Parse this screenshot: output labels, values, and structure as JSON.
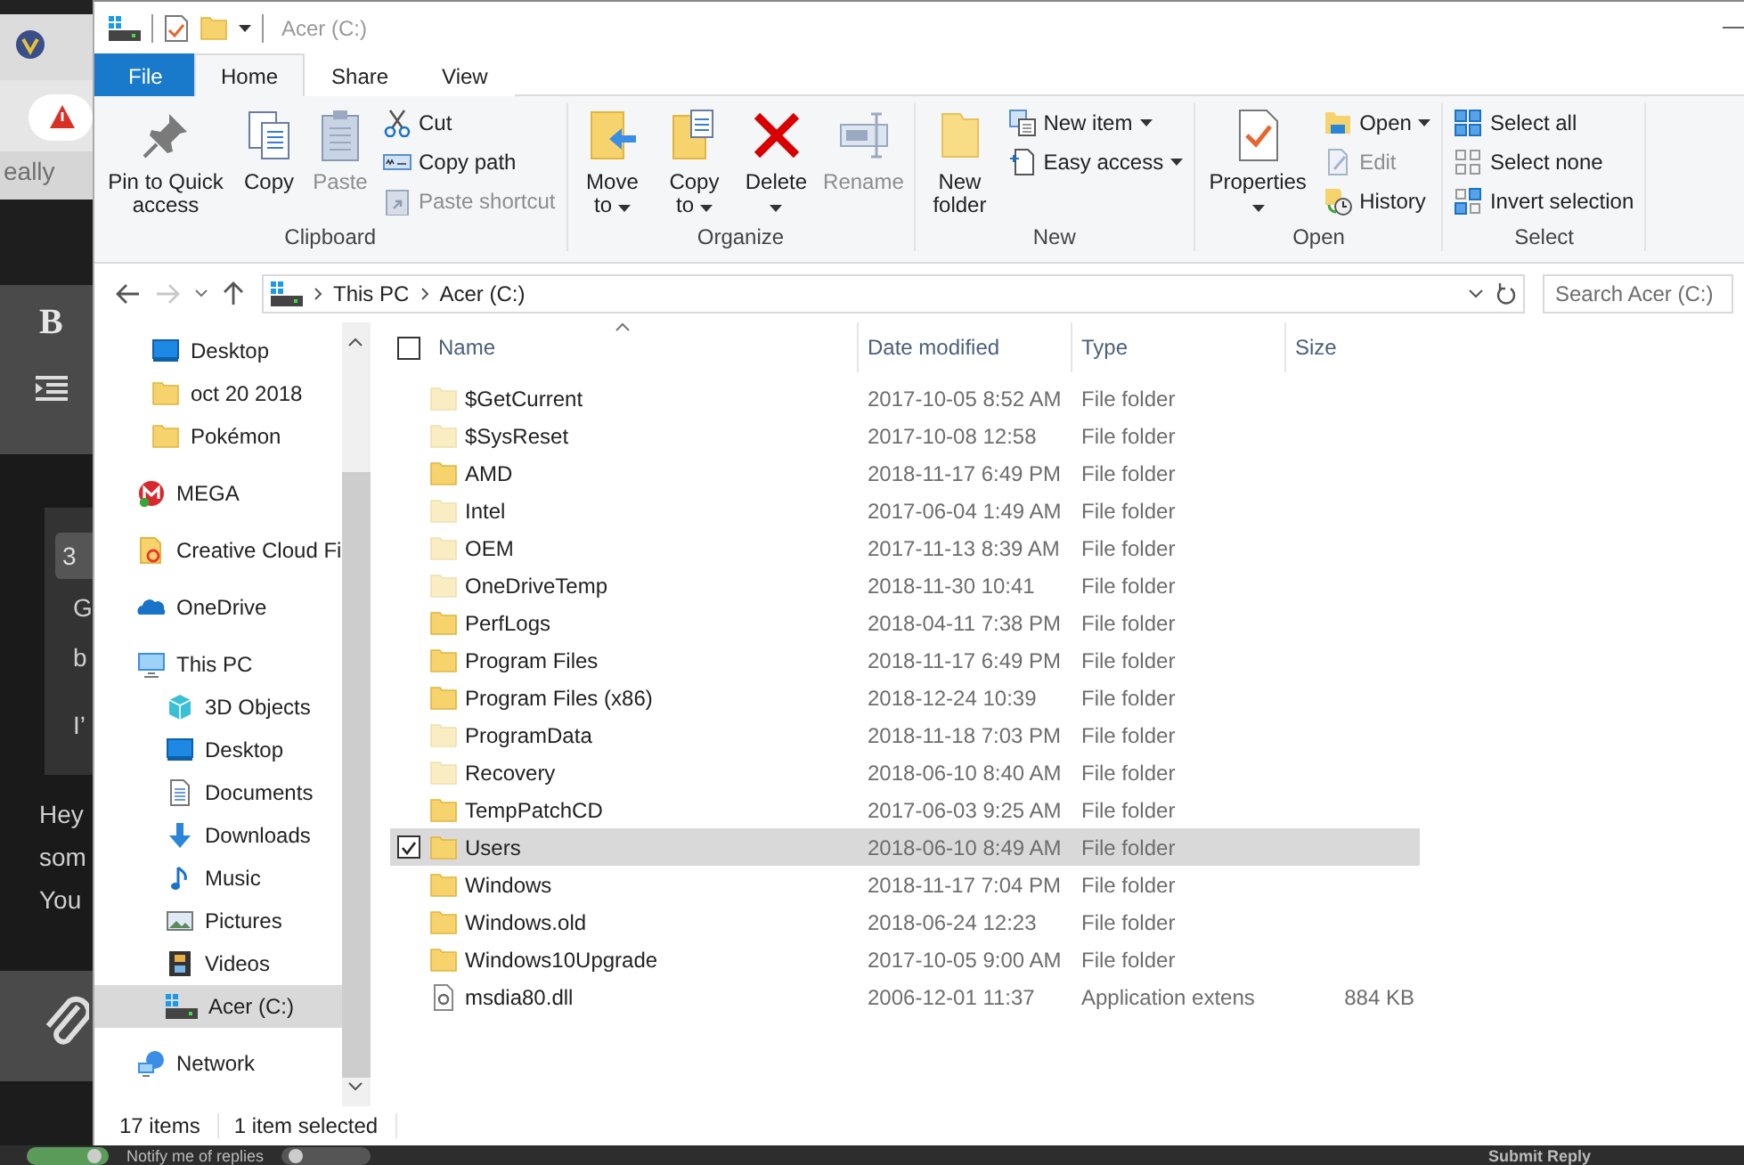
{
  "background_page": {
    "faint_text": "eally",
    "toolbar": {
      "bold": "B"
    },
    "card": {
      "chip": "3",
      "lines": [
        "G",
        "b",
        "I’"
      ]
    },
    "lines": [
      "Hey",
      "som",
      "You"
    ],
    "footer": {
      "notify_toggle": {
        "on": true
      },
      "notify": "Notify me of replies",
      "second_toggle": {
        "on": false
      },
      "submit": "Submit Reply"
    }
  },
  "window": {
    "title": "Acer (C:)"
  },
  "ribbon": {
    "tabs": [
      {
        "label": "File",
        "kind": "file",
        "selected": false
      },
      {
        "label": "Home",
        "kind": "tab",
        "selected": true
      },
      {
        "label": "Share",
        "kind": "tab",
        "selected": false
      },
      {
        "label": "View",
        "kind": "tab",
        "selected": false
      }
    ],
    "groups": [
      {
        "label": "Clipboard",
        "commands": [
          {
            "label": "Pin to Quick access",
            "kind": "pin",
            "large": true,
            "disabled": false,
            "dropdown": false
          },
          {
            "label": "Copy",
            "kind": "copy",
            "large": true,
            "disabled": false,
            "dropdown": false
          },
          {
            "label": "Paste",
            "kind": "paste",
            "large": true,
            "disabled": true,
            "dropdown": false
          },
          {
            "label": "Cut",
            "kind": "cut",
            "large": false,
            "disabled": false,
            "dropdown": false
          },
          {
            "label": "Copy path",
            "kind": "copy-path",
            "large": false,
            "disabled": false,
            "dropdown": false
          },
          {
            "label": "Paste shortcut",
            "kind": "paste-shortcut",
            "large": false,
            "disabled": true,
            "dropdown": false
          }
        ]
      },
      {
        "label": "Organize",
        "commands": [
          {
            "label": "Move to",
            "kind": "move-to",
            "large": true,
            "disabled": false,
            "dropdown": true
          },
          {
            "label": "Copy to",
            "kind": "copy-to",
            "large": true,
            "disabled": false,
            "dropdown": true
          },
          {
            "label": "Delete",
            "kind": "delete",
            "large": true,
            "disabled": false,
            "dropdown": true
          },
          {
            "label": "Rename",
            "kind": "rename",
            "large": true,
            "disabled": true,
            "dropdown": false
          }
        ]
      },
      {
        "label": "New",
        "commands": [
          {
            "label": "New folder",
            "kind": "new-folder",
            "large": true,
            "disabled": false,
            "dropdown": false
          },
          {
            "label": "New item",
            "kind": "new-item",
            "large": false,
            "disabled": false,
            "dropdown": true
          },
          {
            "label": "Easy access",
            "kind": "easy-access",
            "large": false,
            "disabled": false,
            "dropdown": true
          }
        ]
      },
      {
        "label": "Open",
        "commands": [
          {
            "label": "Properties",
            "kind": "properties",
            "large": true,
            "disabled": false,
            "dropdown": true
          },
          {
            "label": "Open",
            "kind": "open",
            "large": false,
            "disabled": false,
            "dropdown": true
          },
          {
            "label": "Edit",
            "kind": "edit",
            "large": false,
            "disabled": true,
            "dropdown": false
          },
          {
            "label": "History",
            "kind": "history",
            "large": false,
            "disabled": false,
            "dropdown": false
          }
        ]
      },
      {
        "label": "Select",
        "commands": [
          {
            "label": "Select all",
            "kind": "select-all",
            "large": false,
            "disabled": false,
            "dropdown": false
          },
          {
            "label": "Select none",
            "kind": "select-none",
            "large": false,
            "disabled": false,
            "dropdown": false
          },
          {
            "label": "Invert selection",
            "kind": "invert-selection",
            "large": false,
            "disabled": false,
            "dropdown": false
          }
        ]
      }
    ]
  },
  "address_bar": {
    "segments": [
      "This PC",
      "Acer (C:)"
    ],
    "search": {
      "placeholder": "Search Acer (C:)"
    }
  },
  "nav_pane": {
    "continued_items": [
      {
        "label": "Desktop",
        "kind": "desktop",
        "selected": false
      },
      {
        "label": "oct 20 2018",
        "kind": "folder",
        "selected": false
      },
      {
        "label": "Pokémon",
        "kind": "folder",
        "selected": false
      }
    ],
    "items": [
      {
        "label": "MEGA",
        "kind": "mega",
        "selected": false
      },
      {
        "label": "Creative Cloud Fi",
        "kind": "cloud-folder",
        "selected": false
      },
      {
        "label": "OneDrive",
        "kind": "onedrive",
        "selected": false
      },
      {
        "label": "This PC",
        "kind": "pc",
        "selected": false,
        "children": [
          {
            "label": "3D Objects",
            "kind": "objects",
            "selected": false
          },
          {
            "label": "Desktop",
            "kind": "desktop",
            "selected": false
          },
          {
            "label": "Documents",
            "kind": "documents",
            "selected": false
          },
          {
            "label": "Downloads",
            "kind": "downloads",
            "selected": false
          },
          {
            "label": "Music",
            "kind": "music",
            "selected": false
          },
          {
            "label": "Pictures",
            "kind": "pictures",
            "selected": false
          },
          {
            "label": "Videos",
            "kind": "videos",
            "selected": false
          },
          {
            "label": "Acer (C:)",
            "kind": "drive",
            "selected": true
          }
        ]
      },
      {
        "label": "Network",
        "kind": "network",
        "selected": false
      }
    ]
  },
  "file_list": {
    "select_all_checkbox": {
      "checked": false
    },
    "columns": [
      "Name",
      "Date modified",
      "Type",
      "Size"
    ],
    "rows": [
      {
        "name": "$GetCurrent",
        "date": "2017-10-05 8:52 AM",
        "type": "File folder",
        "kind": "folder",
        "hidden": true,
        "selected": false,
        "checked": false
      },
      {
        "name": "$SysReset",
        "date": "2017-10-08 12:58",
        "type": "File folder",
        "kind": "folder",
        "hidden": true,
        "selected": false,
        "checked": false
      },
      {
        "name": "AMD",
        "date": "2018-11-17 6:49 PM",
        "type": "File folder",
        "kind": "folder",
        "hidden": false,
        "selected": false,
        "checked": false
      },
      {
        "name": "Intel",
        "date": "2017-06-04 1:49 AM",
        "type": "File folder",
        "kind": "folder",
        "hidden": true,
        "selected": false,
        "checked": false
      },
      {
        "name": "OEM",
        "date": "2017-11-13 8:39 AM",
        "type": "File folder",
        "kind": "folder",
        "hidden": true,
        "selected": false,
        "checked": false
      },
      {
        "name": "OneDriveTemp",
        "date": "2018-11-30 10:41",
        "type": "File folder",
        "kind": "folder",
        "hidden": true,
        "selected": false,
        "checked": false
      },
      {
        "name": "PerfLogs",
        "date": "2018-04-11 7:38 PM",
        "type": "File folder",
        "kind": "folder",
        "hidden": false,
        "selected": false,
        "checked": false
      },
      {
        "name": "Program Files",
        "date": "2018-11-17 6:49 PM",
        "type": "File folder",
        "kind": "folder",
        "hidden": false,
        "selected": false,
        "checked": false
      },
      {
        "name": "Program Files (x86)",
        "date": "2018-12-24 10:39",
        "type": "File folder",
        "kind": "folder",
        "hidden": false,
        "selected": false,
        "checked": false
      },
      {
        "name": "ProgramData",
        "date": "2018-11-18 7:03 PM",
        "type": "File folder",
        "kind": "folder",
        "hidden": true,
        "selected": false,
        "checked": false
      },
      {
        "name": "Recovery",
        "date": "2018-06-10 8:40 AM",
        "type": "File folder",
        "kind": "folder",
        "hidden": true,
        "selected": false,
        "checked": false
      },
      {
        "name": "TempPatchCD",
        "date": "2017-06-03 9:25 AM",
        "type": "File folder",
        "kind": "folder",
        "hidden": false,
        "selected": false,
        "checked": false
      },
      {
        "name": "Users",
        "date": "2018-06-10 8:49 AM",
        "type": "File folder",
        "kind": "folder",
        "hidden": false,
        "selected": true,
        "checked": true
      },
      {
        "name": "Windows",
        "date": "2018-11-17 7:04 PM",
        "type": "File folder",
        "kind": "folder",
        "hidden": false,
        "selected": false,
        "checked": false
      },
      {
        "name": "Windows.old",
        "date": "2018-06-24 12:23",
        "type": "File folder",
        "kind": "folder",
        "hidden": false,
        "selected": false,
        "checked": false
      },
      {
        "name": "Windows10Upgrade",
        "date": "2017-10-05 9:00 AM",
        "type": "File folder",
        "kind": "folder",
        "hidden": false,
        "selected": false,
        "checked": false
      },
      {
        "name": "msdia80.dll",
        "date": "2006-12-01 11:37",
        "type": "Application extens",
        "size": "884 KB",
        "kind": "file",
        "hidden": false,
        "selected": false,
        "checked": false
      }
    ]
  },
  "status_bar": {
    "item_count": "17 items",
    "selection": "1 item selected"
  }
}
